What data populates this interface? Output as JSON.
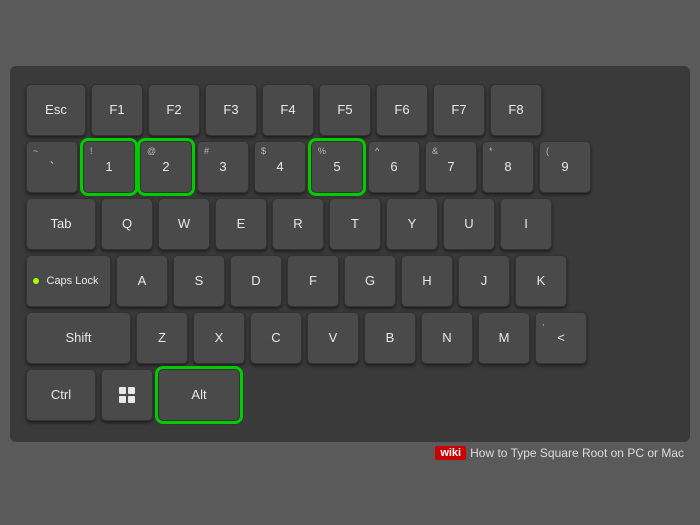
{
  "keyboard": {
    "rows": [
      {
        "id": "row-function",
        "keys": [
          {
            "id": "esc",
            "label": "Esc",
            "wide": "esc-key",
            "symbol": "",
            "highlighted": false
          },
          {
            "id": "f1",
            "label": "F1",
            "wide": "",
            "symbol": "",
            "highlighted": false
          },
          {
            "id": "f2",
            "label": "F2",
            "wide": "",
            "symbol": "",
            "highlighted": false
          },
          {
            "id": "f3",
            "label": "F3",
            "wide": "",
            "symbol": "",
            "highlighted": false
          },
          {
            "id": "f4",
            "label": "F4",
            "wide": "",
            "symbol": "",
            "highlighted": false
          },
          {
            "id": "f5",
            "label": "F5",
            "wide": "",
            "symbol": "",
            "highlighted": false
          },
          {
            "id": "f6",
            "label": "F6",
            "wide": "",
            "symbol": "",
            "highlighted": false
          },
          {
            "id": "f7",
            "label": "F7",
            "wide": "",
            "symbol": "",
            "highlighted": false
          },
          {
            "id": "f8",
            "label": "F8",
            "wide": "",
            "symbol": "",
            "highlighted": false
          }
        ]
      },
      {
        "id": "row-number",
        "keys": [
          {
            "id": "backtick",
            "label": "`",
            "wide": "",
            "symbol": "~",
            "highlighted": false
          },
          {
            "id": "1",
            "label": "1",
            "wide": "",
            "symbol": "!",
            "highlighted": true
          },
          {
            "id": "2",
            "label": "2",
            "wide": "",
            "symbol": "@",
            "highlighted": true
          },
          {
            "id": "3",
            "label": "3",
            "wide": "",
            "symbol": "#",
            "highlighted": false
          },
          {
            "id": "4",
            "label": "4",
            "wide": "",
            "symbol": "$",
            "highlighted": false
          },
          {
            "id": "5",
            "label": "5",
            "wide": "",
            "symbol": "%",
            "highlighted": true
          },
          {
            "id": "6",
            "label": "6",
            "wide": "",
            "symbol": "^",
            "highlighted": false
          },
          {
            "id": "7",
            "label": "7",
            "wide": "",
            "symbol": "&",
            "highlighted": false
          },
          {
            "id": "8",
            "label": "8",
            "wide": "",
            "symbol": "*",
            "highlighted": false
          },
          {
            "id": "9",
            "label": "9",
            "wide": "",
            "symbol": "(",
            "highlighted": false
          }
        ]
      },
      {
        "id": "row-qwerty",
        "keys": [
          {
            "id": "tab",
            "label": "Tab",
            "wide": "tab-key",
            "symbol": "",
            "highlighted": false
          },
          {
            "id": "q",
            "label": "Q",
            "wide": "",
            "symbol": "",
            "highlighted": false
          },
          {
            "id": "w",
            "label": "W",
            "wide": "",
            "symbol": "",
            "highlighted": false
          },
          {
            "id": "e",
            "label": "E",
            "wide": "",
            "symbol": "",
            "highlighted": false
          },
          {
            "id": "r",
            "label": "R",
            "wide": "",
            "symbol": "",
            "highlighted": false
          },
          {
            "id": "t",
            "label": "T",
            "wide": "",
            "symbol": "",
            "highlighted": false
          },
          {
            "id": "y",
            "label": "Y",
            "wide": "",
            "symbol": "",
            "highlighted": false
          },
          {
            "id": "u",
            "label": "U",
            "wide": "",
            "symbol": "",
            "highlighted": false
          },
          {
            "id": "i",
            "label": "I",
            "wide": "",
            "symbol": "",
            "highlighted": false
          }
        ]
      },
      {
        "id": "row-asdf",
        "keys": [
          {
            "id": "caps",
            "label": "Caps Lock",
            "wide": "caps-key",
            "symbol": "",
            "highlighted": false,
            "hasindicator": true
          },
          {
            "id": "a",
            "label": "A",
            "wide": "",
            "symbol": "",
            "highlighted": false
          },
          {
            "id": "s",
            "label": "S",
            "wide": "",
            "symbol": "",
            "highlighted": false
          },
          {
            "id": "d",
            "label": "D",
            "wide": "",
            "symbol": "",
            "highlighted": false
          },
          {
            "id": "f",
            "label": "F",
            "wide": "",
            "symbol": "",
            "highlighted": false
          },
          {
            "id": "g",
            "label": "G",
            "wide": "",
            "symbol": "",
            "highlighted": false
          },
          {
            "id": "h",
            "label": "H",
            "wide": "",
            "symbol": "",
            "highlighted": false
          },
          {
            "id": "j",
            "label": "J",
            "wide": "",
            "symbol": "",
            "highlighted": false
          },
          {
            "id": "k",
            "label": "K",
            "wide": "",
            "symbol": "",
            "highlighted": false
          }
        ]
      },
      {
        "id": "row-zxcv",
        "keys": [
          {
            "id": "shift",
            "label": "Shift",
            "wide": "shift-key",
            "symbol": "",
            "highlighted": false
          },
          {
            "id": "z",
            "label": "Z",
            "wide": "",
            "symbol": "",
            "highlighted": false
          },
          {
            "id": "x",
            "label": "X",
            "wide": "",
            "symbol": "",
            "highlighted": false
          },
          {
            "id": "c",
            "label": "C",
            "wide": "",
            "symbol": "",
            "highlighted": false
          },
          {
            "id": "v",
            "label": "V",
            "wide": "",
            "symbol": "",
            "highlighted": false
          },
          {
            "id": "b",
            "label": "B",
            "wide": "",
            "symbol": "",
            "highlighted": false
          },
          {
            "id": "n",
            "label": "N",
            "wide": "",
            "symbol": "",
            "highlighted": false
          },
          {
            "id": "m",
            "label": "M",
            "wide": "",
            "symbol": "",
            "highlighted": false
          },
          {
            "id": "lt",
            "label": "<",
            "wide": "",
            "symbol": ",",
            "highlighted": false
          }
        ]
      },
      {
        "id": "row-ctrl",
        "keys": [
          {
            "id": "ctrl",
            "label": "Ctrl",
            "wide": "ctrl-key",
            "symbol": "",
            "highlighted": false
          },
          {
            "id": "win",
            "label": "win",
            "wide": "win-key",
            "symbol": "",
            "highlighted": false,
            "iswin": true
          },
          {
            "id": "alt",
            "label": "Alt",
            "wide": "wider-key",
            "symbol": "",
            "highlighted": true
          }
        ]
      }
    ],
    "watermark": {
      "wiki": "wiki",
      "text": "How to Type Square Root on PC or Mac"
    }
  }
}
